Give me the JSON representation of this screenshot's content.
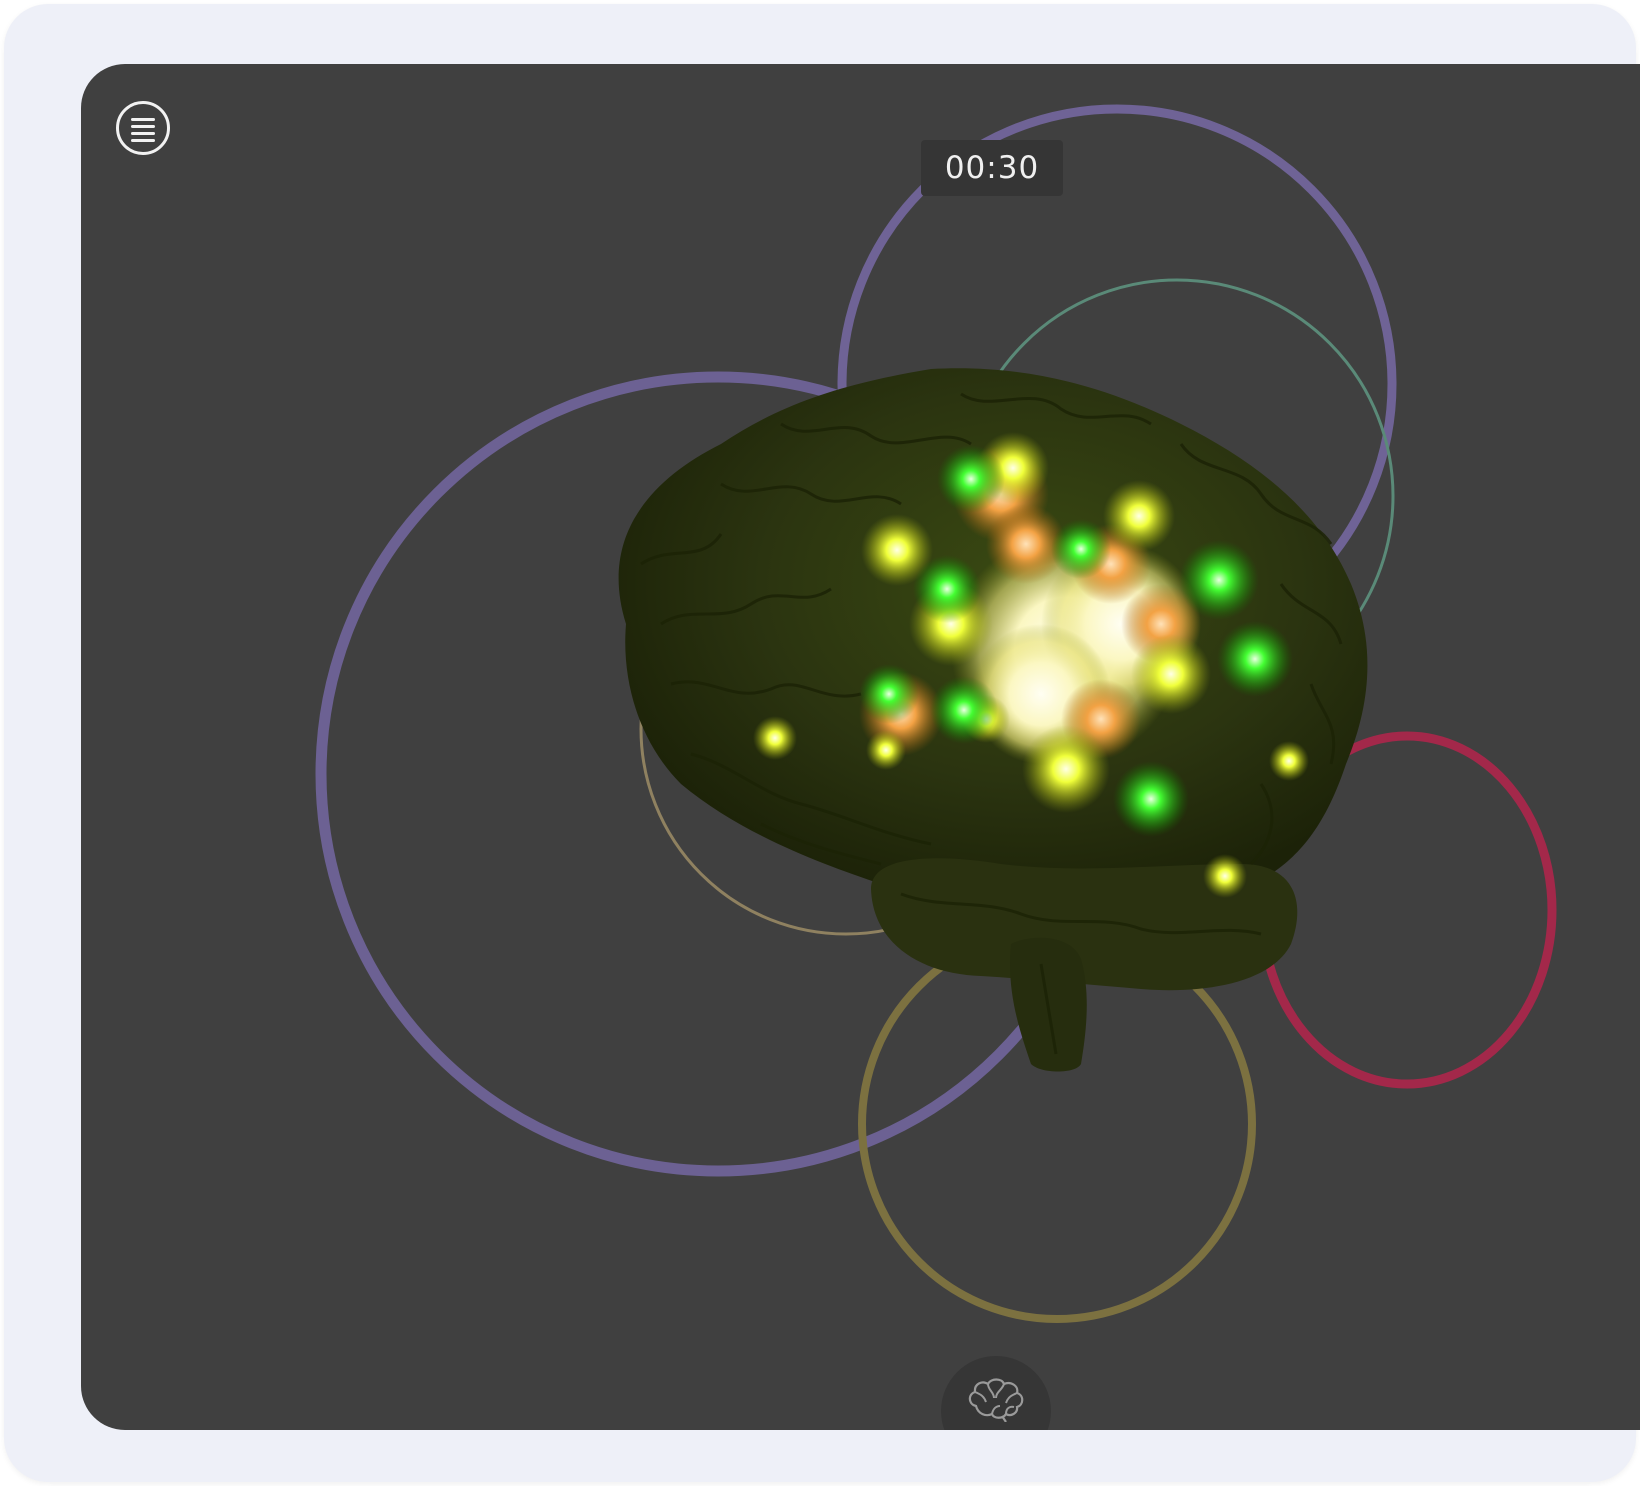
{
  "timer": {
    "value": "00:30"
  },
  "menu": {
    "icon": "hamburger-menu-icon"
  },
  "brain_toggle": {
    "icon": "brain-outline-icon"
  },
  "colors": {
    "frame": "#eef0f8",
    "screen": "#404040",
    "ring_purple": "#6f6396",
    "ring_teal": "#5b8577",
    "ring_tan": "#8a7e5a",
    "ring_olive": "#7a7040",
    "ring_crimson": "#a52a4c",
    "brain": "#2a3010",
    "glow_green": "#33ff33",
    "glow_yellow": "#eaff3a",
    "glow_orange": "#f2a54a",
    "glow_core": "#fffbd0"
  }
}
